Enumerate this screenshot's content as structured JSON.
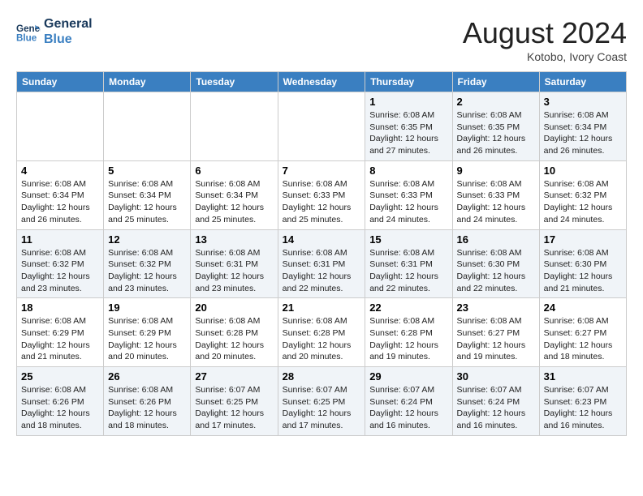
{
  "header": {
    "logo_line1": "General",
    "logo_line2": "Blue",
    "month_year": "August 2024",
    "location": "Kotobo, Ivory Coast"
  },
  "weekdays": [
    "Sunday",
    "Monday",
    "Tuesday",
    "Wednesday",
    "Thursday",
    "Friday",
    "Saturday"
  ],
  "weeks": [
    [
      {
        "day": "",
        "info": ""
      },
      {
        "day": "",
        "info": ""
      },
      {
        "day": "",
        "info": ""
      },
      {
        "day": "",
        "info": ""
      },
      {
        "day": "1",
        "info": "Sunrise: 6:08 AM\nSunset: 6:35 PM\nDaylight: 12 hours\nand 27 minutes."
      },
      {
        "day": "2",
        "info": "Sunrise: 6:08 AM\nSunset: 6:35 PM\nDaylight: 12 hours\nand 26 minutes."
      },
      {
        "day": "3",
        "info": "Sunrise: 6:08 AM\nSunset: 6:34 PM\nDaylight: 12 hours\nand 26 minutes."
      }
    ],
    [
      {
        "day": "4",
        "info": "Sunrise: 6:08 AM\nSunset: 6:34 PM\nDaylight: 12 hours\nand 26 minutes."
      },
      {
        "day": "5",
        "info": "Sunrise: 6:08 AM\nSunset: 6:34 PM\nDaylight: 12 hours\nand 25 minutes."
      },
      {
        "day": "6",
        "info": "Sunrise: 6:08 AM\nSunset: 6:34 PM\nDaylight: 12 hours\nand 25 minutes."
      },
      {
        "day": "7",
        "info": "Sunrise: 6:08 AM\nSunset: 6:33 PM\nDaylight: 12 hours\nand 25 minutes."
      },
      {
        "day": "8",
        "info": "Sunrise: 6:08 AM\nSunset: 6:33 PM\nDaylight: 12 hours\nand 24 minutes."
      },
      {
        "day": "9",
        "info": "Sunrise: 6:08 AM\nSunset: 6:33 PM\nDaylight: 12 hours\nand 24 minutes."
      },
      {
        "day": "10",
        "info": "Sunrise: 6:08 AM\nSunset: 6:32 PM\nDaylight: 12 hours\nand 24 minutes."
      }
    ],
    [
      {
        "day": "11",
        "info": "Sunrise: 6:08 AM\nSunset: 6:32 PM\nDaylight: 12 hours\nand 23 minutes."
      },
      {
        "day": "12",
        "info": "Sunrise: 6:08 AM\nSunset: 6:32 PM\nDaylight: 12 hours\nand 23 minutes."
      },
      {
        "day": "13",
        "info": "Sunrise: 6:08 AM\nSunset: 6:31 PM\nDaylight: 12 hours\nand 23 minutes."
      },
      {
        "day": "14",
        "info": "Sunrise: 6:08 AM\nSunset: 6:31 PM\nDaylight: 12 hours\nand 22 minutes."
      },
      {
        "day": "15",
        "info": "Sunrise: 6:08 AM\nSunset: 6:31 PM\nDaylight: 12 hours\nand 22 minutes."
      },
      {
        "day": "16",
        "info": "Sunrise: 6:08 AM\nSunset: 6:30 PM\nDaylight: 12 hours\nand 22 minutes."
      },
      {
        "day": "17",
        "info": "Sunrise: 6:08 AM\nSunset: 6:30 PM\nDaylight: 12 hours\nand 21 minutes."
      }
    ],
    [
      {
        "day": "18",
        "info": "Sunrise: 6:08 AM\nSunset: 6:29 PM\nDaylight: 12 hours\nand 21 minutes."
      },
      {
        "day": "19",
        "info": "Sunrise: 6:08 AM\nSunset: 6:29 PM\nDaylight: 12 hours\nand 20 minutes."
      },
      {
        "day": "20",
        "info": "Sunrise: 6:08 AM\nSunset: 6:28 PM\nDaylight: 12 hours\nand 20 minutes."
      },
      {
        "day": "21",
        "info": "Sunrise: 6:08 AM\nSunset: 6:28 PM\nDaylight: 12 hours\nand 20 minutes."
      },
      {
        "day": "22",
        "info": "Sunrise: 6:08 AM\nSunset: 6:28 PM\nDaylight: 12 hours\nand 19 minutes."
      },
      {
        "day": "23",
        "info": "Sunrise: 6:08 AM\nSunset: 6:27 PM\nDaylight: 12 hours\nand 19 minutes."
      },
      {
        "day": "24",
        "info": "Sunrise: 6:08 AM\nSunset: 6:27 PM\nDaylight: 12 hours\nand 18 minutes."
      }
    ],
    [
      {
        "day": "25",
        "info": "Sunrise: 6:08 AM\nSunset: 6:26 PM\nDaylight: 12 hours\nand 18 minutes."
      },
      {
        "day": "26",
        "info": "Sunrise: 6:08 AM\nSunset: 6:26 PM\nDaylight: 12 hours\nand 18 minutes."
      },
      {
        "day": "27",
        "info": "Sunrise: 6:07 AM\nSunset: 6:25 PM\nDaylight: 12 hours\nand 17 minutes."
      },
      {
        "day": "28",
        "info": "Sunrise: 6:07 AM\nSunset: 6:25 PM\nDaylight: 12 hours\nand 17 minutes."
      },
      {
        "day": "29",
        "info": "Sunrise: 6:07 AM\nSunset: 6:24 PM\nDaylight: 12 hours\nand 16 minutes."
      },
      {
        "day": "30",
        "info": "Sunrise: 6:07 AM\nSunset: 6:24 PM\nDaylight: 12 hours\nand 16 minutes."
      },
      {
        "day": "31",
        "info": "Sunrise: 6:07 AM\nSunset: 6:23 PM\nDaylight: 12 hours\nand 16 minutes."
      }
    ]
  ]
}
